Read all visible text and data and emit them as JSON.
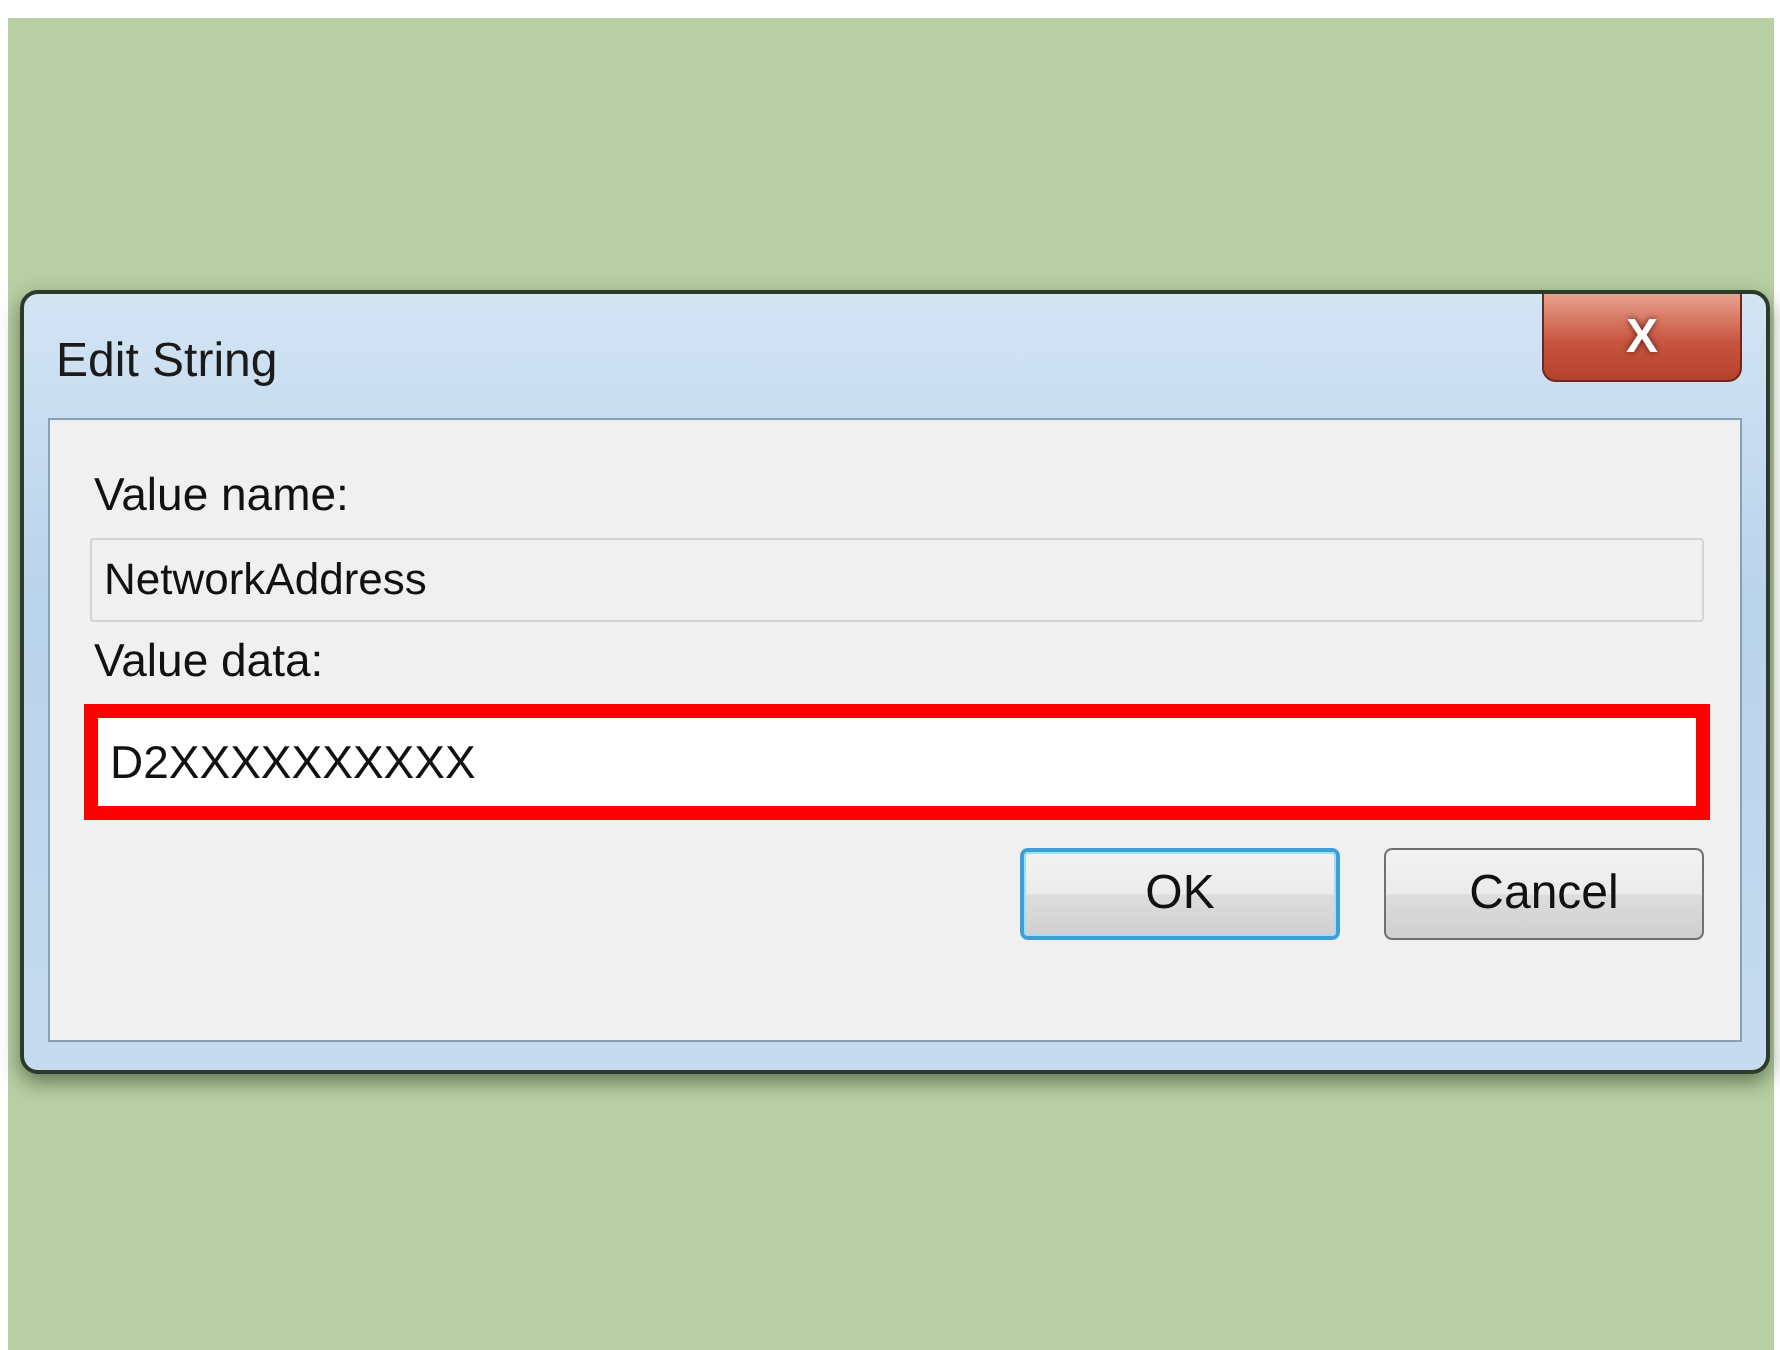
{
  "window": {
    "title": "Edit String",
    "close_symbol": "X"
  },
  "value_name": {
    "label": "Value name:",
    "value": "NetworkAddress",
    "readonly": true
  },
  "value_data": {
    "label": "Value data:",
    "value": "D2XXXXXXXXXX",
    "highlighted": true
  },
  "buttons": [
    {
      "label": "OK",
      "default": true
    },
    {
      "label": "Cancel",
      "default": false
    }
  ]
}
